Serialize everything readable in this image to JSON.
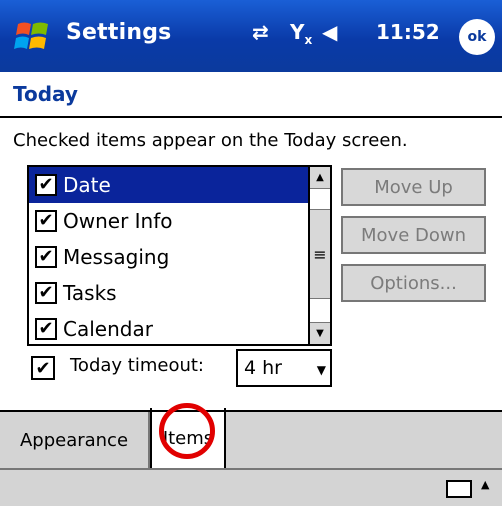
{
  "window": {
    "title": "Settings",
    "ok_label": "ok",
    "clock": "11:52",
    "tray_icons": [
      "sync-icon",
      "signal-icon",
      "speaker-icon"
    ]
  },
  "header": {
    "title": "Today"
  },
  "instructions": "Checked items appear on the Today screen.",
  "items_list": [
    {
      "label": "Date",
      "checked": true,
      "selected": true
    },
    {
      "label": "Owner Info",
      "checked": true,
      "selected": false
    },
    {
      "label": "Messaging",
      "checked": true,
      "selected": false
    },
    {
      "label": "Tasks",
      "checked": true,
      "selected": false
    },
    {
      "label": "Calendar",
      "checked": true,
      "selected": false
    }
  ],
  "buttons": {
    "move_up": "Move Up",
    "move_down": "Move Down",
    "options": "Options..."
  },
  "timeout": {
    "checked": true,
    "label": "Today timeout:",
    "value": "4 hr"
  },
  "tabs": {
    "appearance": "Appearance",
    "items": "Items",
    "active": "Items"
  },
  "colors": {
    "title_bar": "#0b3a9d",
    "selection": "#0a249b",
    "highlight_circle": "#e10000"
  }
}
